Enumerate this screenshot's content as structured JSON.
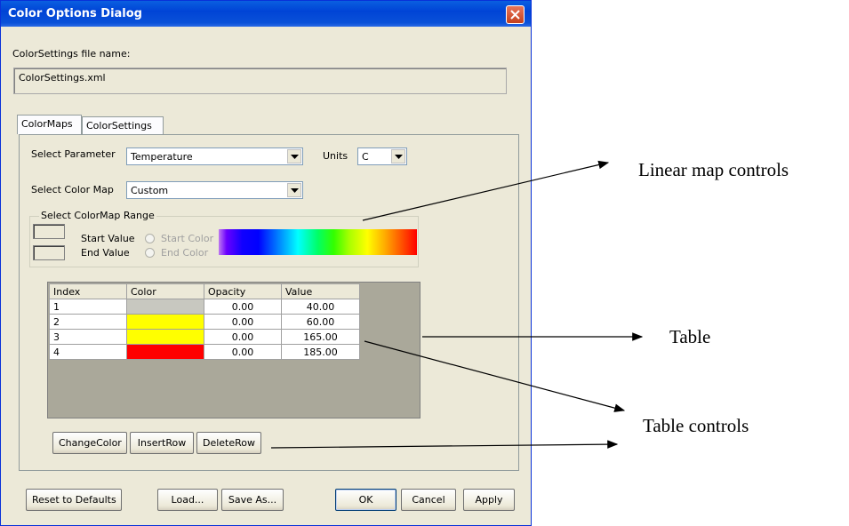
{
  "dialog": {
    "title": "Color Options Dialog",
    "settings_file_label": "ColorSettings file name:",
    "settings_file_value": "ColorSettings.xml",
    "tabs": [
      {
        "label": "ColorMaps",
        "active": true
      },
      {
        "label": "ColorSettings",
        "active": false
      }
    ],
    "select_parameter_label": "Select Parameter",
    "select_parameter_value": "Temperature",
    "units_label": "Units",
    "units_value": "C",
    "select_colormap_label": "Select Color Map",
    "select_colormap_value": "Custom",
    "range_group": {
      "title": "Select ColorMap Range",
      "start_value_label": "Start Value",
      "end_value_label": "End Value",
      "start_color_label": "Start Color",
      "end_color_label": "End Color"
    },
    "table": {
      "columns": [
        "Index",
        "Color",
        "Opacity",
        "Value"
      ],
      "rows": [
        {
          "index": "1",
          "color": "#c8c8c0",
          "opacity": "0.00",
          "value": "40.00"
        },
        {
          "index": "2",
          "color": "#ffff00",
          "opacity": "0.00",
          "value": "60.00"
        },
        {
          "index": "3",
          "color": "#ffff00",
          "opacity": "0.00",
          "value": "165.00"
        },
        {
          "index": "4",
          "color": "#ff0000",
          "opacity": "0.00",
          "value": "185.00"
        }
      ]
    },
    "table_buttons": {
      "change_color": "ChangeColor",
      "insert_row": "InsertRow",
      "delete_row": "DeleteRow"
    },
    "footer_buttons": {
      "reset": "Reset to Defaults",
      "load": "Load...",
      "save_as": "Save As...",
      "ok": "OK",
      "cancel": "Cancel",
      "apply": "Apply"
    }
  },
  "annotations": {
    "linear_map_controls": "Linear map controls",
    "table": "Table",
    "table_controls": "Table controls"
  },
  "colors": {
    "title_bar": "#0a51d8",
    "dialog_bg": "#ece9d8",
    "grid_bg": "#aaa89a"
  }
}
